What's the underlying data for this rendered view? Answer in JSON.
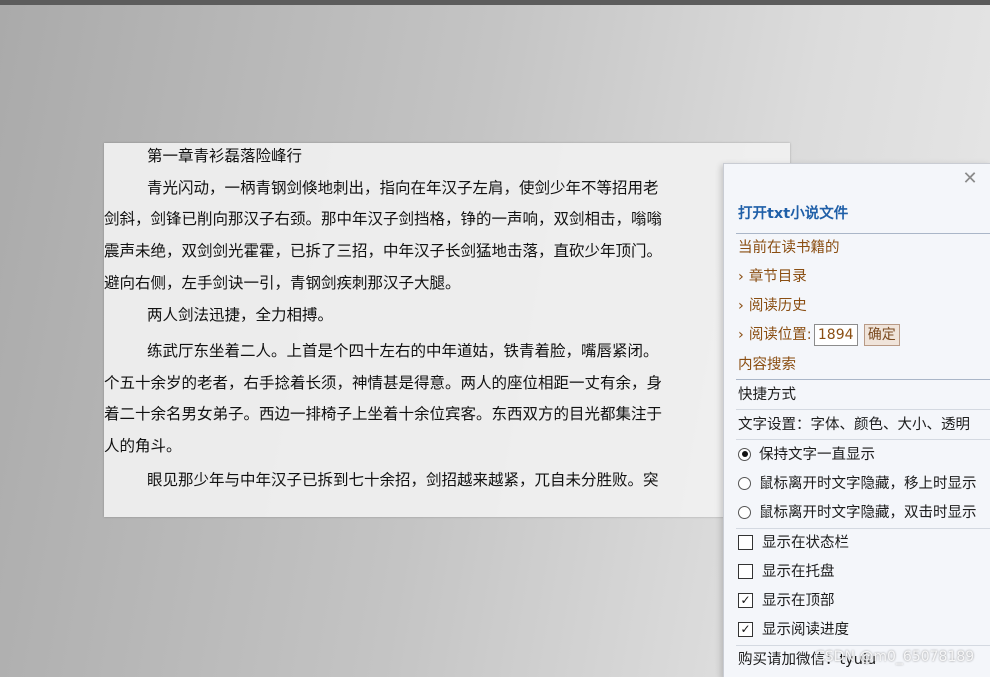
{
  "reader": {
    "lines": [
      "第一章青衫磊落险峰行",
      "青光闪动，一柄青钢剑倏地刺出，指向在年汉子左肩，使剑少年不等招用老",
      "剑斜，剑锋已削向那汉子右颈。那中年汉子剑挡格，铮的一声响，双剑相击，嗡嗡",
      "震声未绝，双剑剑光霍霍，已拆了三招，中年汉子长剑猛地击落，直砍少年顶门。",
      "避向右侧，左手剑诀一引，青钢剑疾刺那汉子大腿。",
      "两人剑法迅捷，全力相搏。",
      "练武厅东坐着二人。上首是个四十左右的中年道姑，铁青着脸，嘴唇紧闭。",
      "个五十余岁的老者，右手捻着长须，神情甚是得意。两人的座位相距一丈有余，身",
      "着二十余名男女弟子。西边一排椅子上坐着十余位宾客。东西双方的目光都集注于",
      "人的角斗。",
      "眼见那少年与中年汉子已拆到七十余招，剑招越来越紧，兀自未分胜败。突"
    ]
  },
  "menu": {
    "close_icon": "close-icon",
    "open_file": "打开txt小说文件",
    "current_book": "当前在读书籍的",
    "arrow": "›",
    "chapter_list": "章节目录",
    "read_history": "阅读历史",
    "read_position_label": "阅读位置:",
    "read_position_value": "1894",
    "confirm": "确定",
    "content_search": "内容搜索",
    "shortcuts": "快捷方式",
    "text_settings": "文字设置：字体、颜色、大小、透明",
    "radio_options": [
      {
        "label": "保持文字一直显示",
        "checked": true
      },
      {
        "label": "鼠标离开时文字隐藏，移上时显示",
        "checked": false
      },
      {
        "label": "鼠标离开时文字隐藏，双击时显示",
        "checked": false
      }
    ],
    "check_options": [
      {
        "label": "显示在状态栏",
        "checked": false
      },
      {
        "label": "显示在托盘",
        "checked": false
      },
      {
        "label": "显示在顶部",
        "checked": true
      },
      {
        "label": "显示阅读进度",
        "checked": true
      }
    ],
    "buy_prefix": "购买请加微信：tyuiu",
    "check_mark": "✓"
  },
  "watermark": "CSDN @m0_65078189"
}
